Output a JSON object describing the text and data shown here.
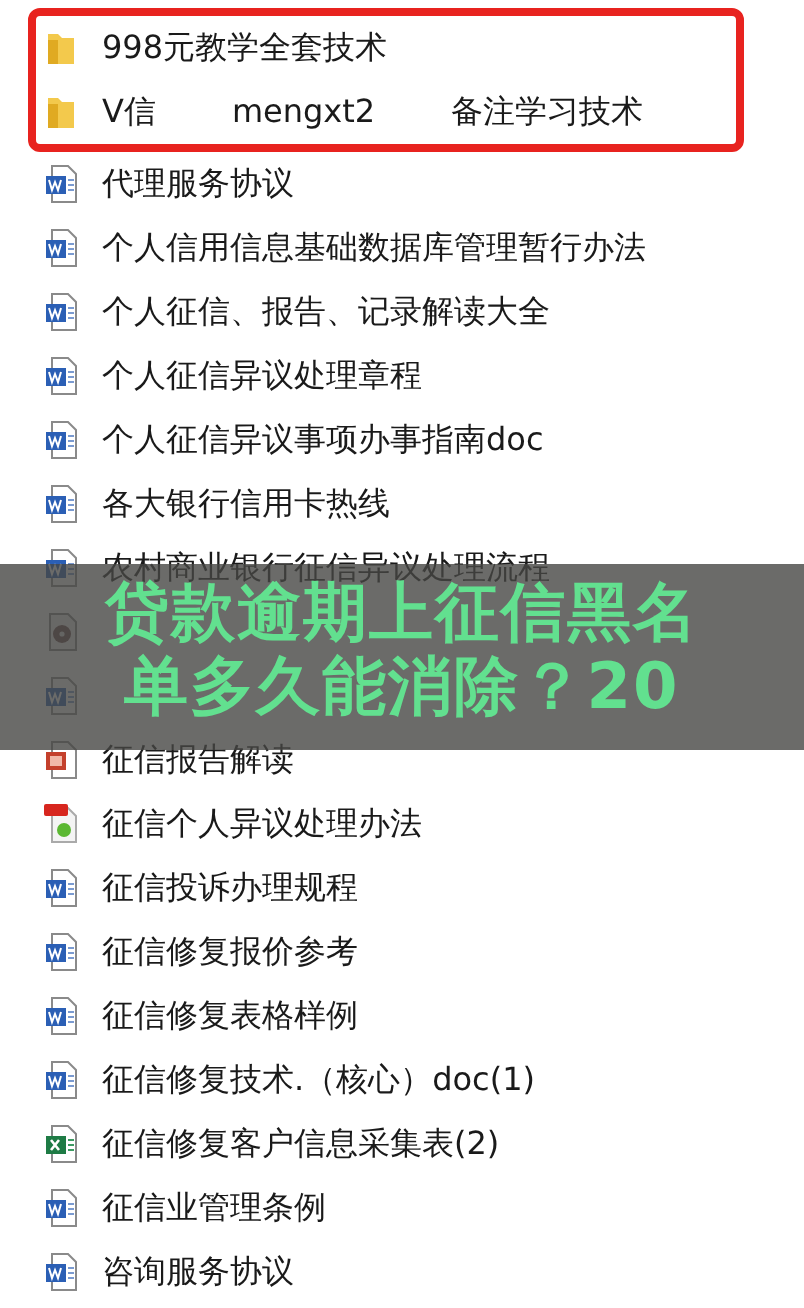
{
  "highlighted_group": {
    "files": [
      {
        "kind": "folder",
        "texts": [
          "998元教学全套技术"
        ]
      },
      {
        "kind": "folder",
        "texts": [
          "V信",
          "mengxt2",
          "备注学习技术"
        ]
      }
    ]
  },
  "files": [
    {
      "kind": "word",
      "texts": [
        "代理服务协议"
      ]
    },
    {
      "kind": "word",
      "texts": [
        "个人信用信息基础数据库管理暂行办法"
      ]
    },
    {
      "kind": "word",
      "texts": [
        "个人征信、报告、记录解读大全"
      ]
    },
    {
      "kind": "word",
      "texts": [
        "个人征信异议处理章程"
      ]
    },
    {
      "kind": "word",
      "texts": [
        "个人征信异议事项办事指南doc"
      ]
    },
    {
      "kind": "word",
      "texts": [
        "各大银行信用卡热线"
      ]
    },
    {
      "kind": "word",
      "texts": [
        "农村商业银行征信异议处理流程"
      ]
    },
    {
      "kind": "media"
    },
    {
      "kind": "word"
    },
    {
      "kind": "slides",
      "texts": [
        "征信报告解读"
      ]
    },
    {
      "kind": "pdf",
      "texts": [
        "征信个人异议处理办法"
      ]
    },
    {
      "kind": "word",
      "texts": [
        "征信投诉办理规程"
      ]
    },
    {
      "kind": "word",
      "texts": [
        "征信修复报价参考"
      ]
    },
    {
      "kind": "word",
      "texts": [
        "征信修复表格样例"
      ]
    },
    {
      "kind": "word",
      "texts": [
        "征信修复技术.（核心）doc(1)"
      ]
    },
    {
      "kind": "excel",
      "texts": [
        "征信修复客户信息采集表(2)"
      ]
    },
    {
      "kind": "word",
      "texts": [
        "征信业管理条例"
      ]
    },
    {
      "kind": "word",
      "texts": [
        "咨询服务协议"
      ]
    }
  ],
  "banner": {
    "lines": [
      "贷款逾期上征信黑名",
      "单多久能消除？20"
    ]
  }
}
